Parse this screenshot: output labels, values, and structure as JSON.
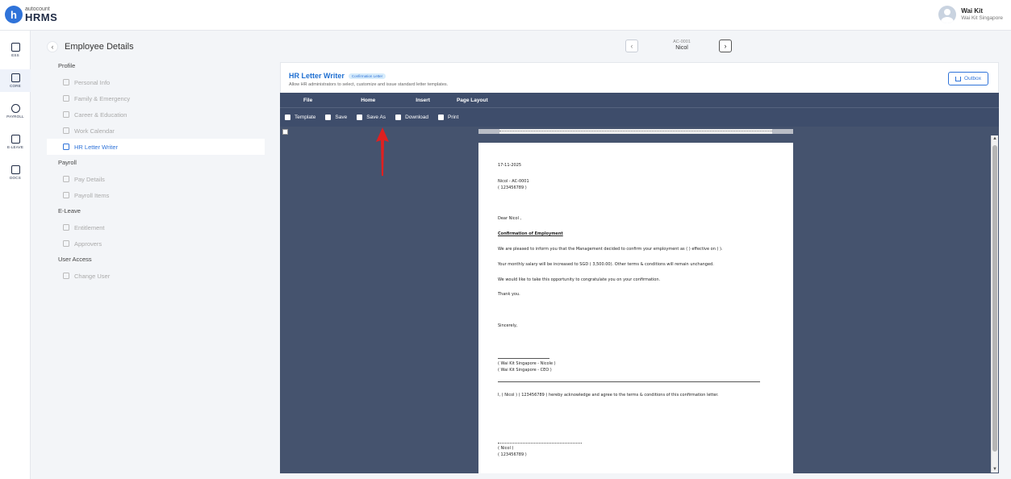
{
  "app": {
    "logo_small": "autocount",
    "logo_big": "HRMS",
    "logo_mark": "h"
  },
  "user": {
    "name": "Wai Kit",
    "org": "Wai Kit Singapore"
  },
  "rail": [
    {
      "label": "ESS",
      "icon": "ess-icon"
    },
    {
      "label": "CORE",
      "icon": "core-icon"
    },
    {
      "label": "PAYROLL",
      "icon": "payroll-icon"
    },
    {
      "label": "E-LEAVE",
      "icon": "calendar-icon"
    },
    {
      "label": "DOCS",
      "icon": "docs-icon"
    }
  ],
  "detail": {
    "back": "‹",
    "title": "Employee Details"
  },
  "nav": {
    "profile": "Profile",
    "personal_info": "Personal Info",
    "family": "Family & Emergency",
    "career": "Career & Education",
    "work_calendar": "Work Calendar",
    "hr_letter": "HR Letter Writer",
    "payroll": "Payroll",
    "pay_details": "Pay Details",
    "payroll_items": "Payroll Items",
    "eleave": "E-Leave",
    "entitlement": "Entitlement",
    "approvers": "Approvers",
    "user_access": "User Access",
    "change_user": "Change User"
  },
  "switcher": {
    "prev": "‹",
    "next": "›",
    "code": "AC-0001",
    "name": "Nicol"
  },
  "panel": {
    "title": "HR Letter Writer",
    "badge": "Confirmation Letter",
    "subtitle": "Allow HR administrators to select, customize and issue standard letter templates.",
    "outbox": "Outbox"
  },
  "ribbon": {
    "tabs": [
      "File",
      "Home",
      "Insert",
      "Page Layout"
    ],
    "tools": [
      "Template",
      "Save",
      "Save As",
      "Download",
      "Print"
    ]
  },
  "letter": {
    "date": "17-11-2025",
    "emp_line": "Nicol  - AC-0001",
    "emp_id": "( 123456789 )",
    "greeting": "Dear Nicol ,",
    "heading": "Confirmation of Employment",
    "p1": "We are pleased to inform you that the Management decided to confirm your employment as (  ) effective on (  ).",
    "p2": "Your monthly salary will be increased to SGD ( 3,500.00). Other terms & conditions will remain unchanged.",
    "p3": "We would like to take this opportunity to congratulate you on your confirmation.",
    "p4": "Thank you.",
    "closing": "Sincerely,",
    "signer1": "( Wai Kit Singapore  - Nicole )",
    "signer2": "( Wai Kit Singapore  - CEO )",
    "ack": "I, ( Nicol  ) ( 123456789 ) hereby acknowledge and agree to the terms & conditions of this confirmation letter.",
    "ack_name": "( Nicol  )",
    "ack_id": "( 123456789 )"
  },
  "colors": {
    "accent": "#2f73d9",
    "ribbon": "#3e4d6b",
    "editor_bg": "#45536e",
    "annotation": "#e02020"
  }
}
